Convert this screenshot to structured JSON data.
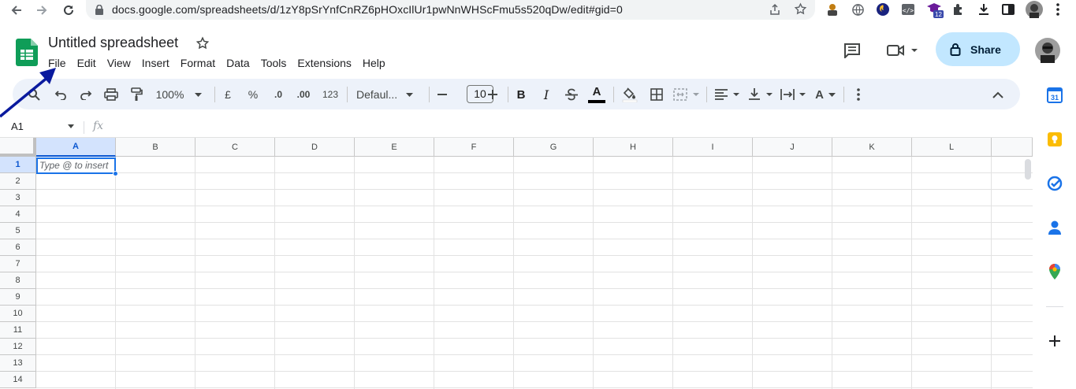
{
  "browser": {
    "url": "docs.google.com/spreadsheets/d/1zY8pSrYnfCnRZ6pHOxcIlUr1pwNnWHScFmu5s520qDw/edit#gid=0",
    "extension_badge": "12"
  },
  "doc": {
    "title": "Untitled spreadsheet",
    "menu": [
      "File",
      "Edit",
      "View",
      "Insert",
      "Format",
      "Data",
      "Tools",
      "Extensions",
      "Help"
    ],
    "share_label": "Share"
  },
  "toolbar": {
    "zoom": "100%",
    "currency": "£",
    "percent": "%",
    "decrease_decimal": ".0",
    "increase_decimal": ".00",
    "more_formats": "123",
    "font": "Defaul...",
    "font_size": "10",
    "bold": "B",
    "italic": "I",
    "text_color_letter": "A",
    "text_rotation_letter": "A"
  },
  "formula_bar": {
    "name_box": "A1",
    "fx": "fx"
  },
  "grid": {
    "columns": [
      "A",
      "B",
      "C",
      "D",
      "E",
      "F",
      "G",
      "H",
      "I",
      "J",
      "K",
      "L"
    ],
    "rows": [
      "1",
      "2",
      "3",
      "4",
      "5",
      "6",
      "7",
      "8",
      "9",
      "10",
      "11",
      "12",
      "13",
      "14"
    ],
    "active_cell_placeholder": "Type @ to insert"
  },
  "side_panel": {
    "calendar_day": "31"
  },
  "colors": {
    "accent": "#1a73e8",
    "share_bg": "#c2e7ff",
    "sheets_green": "#0f9d58",
    "toolbar_bg": "#edf2fa"
  }
}
